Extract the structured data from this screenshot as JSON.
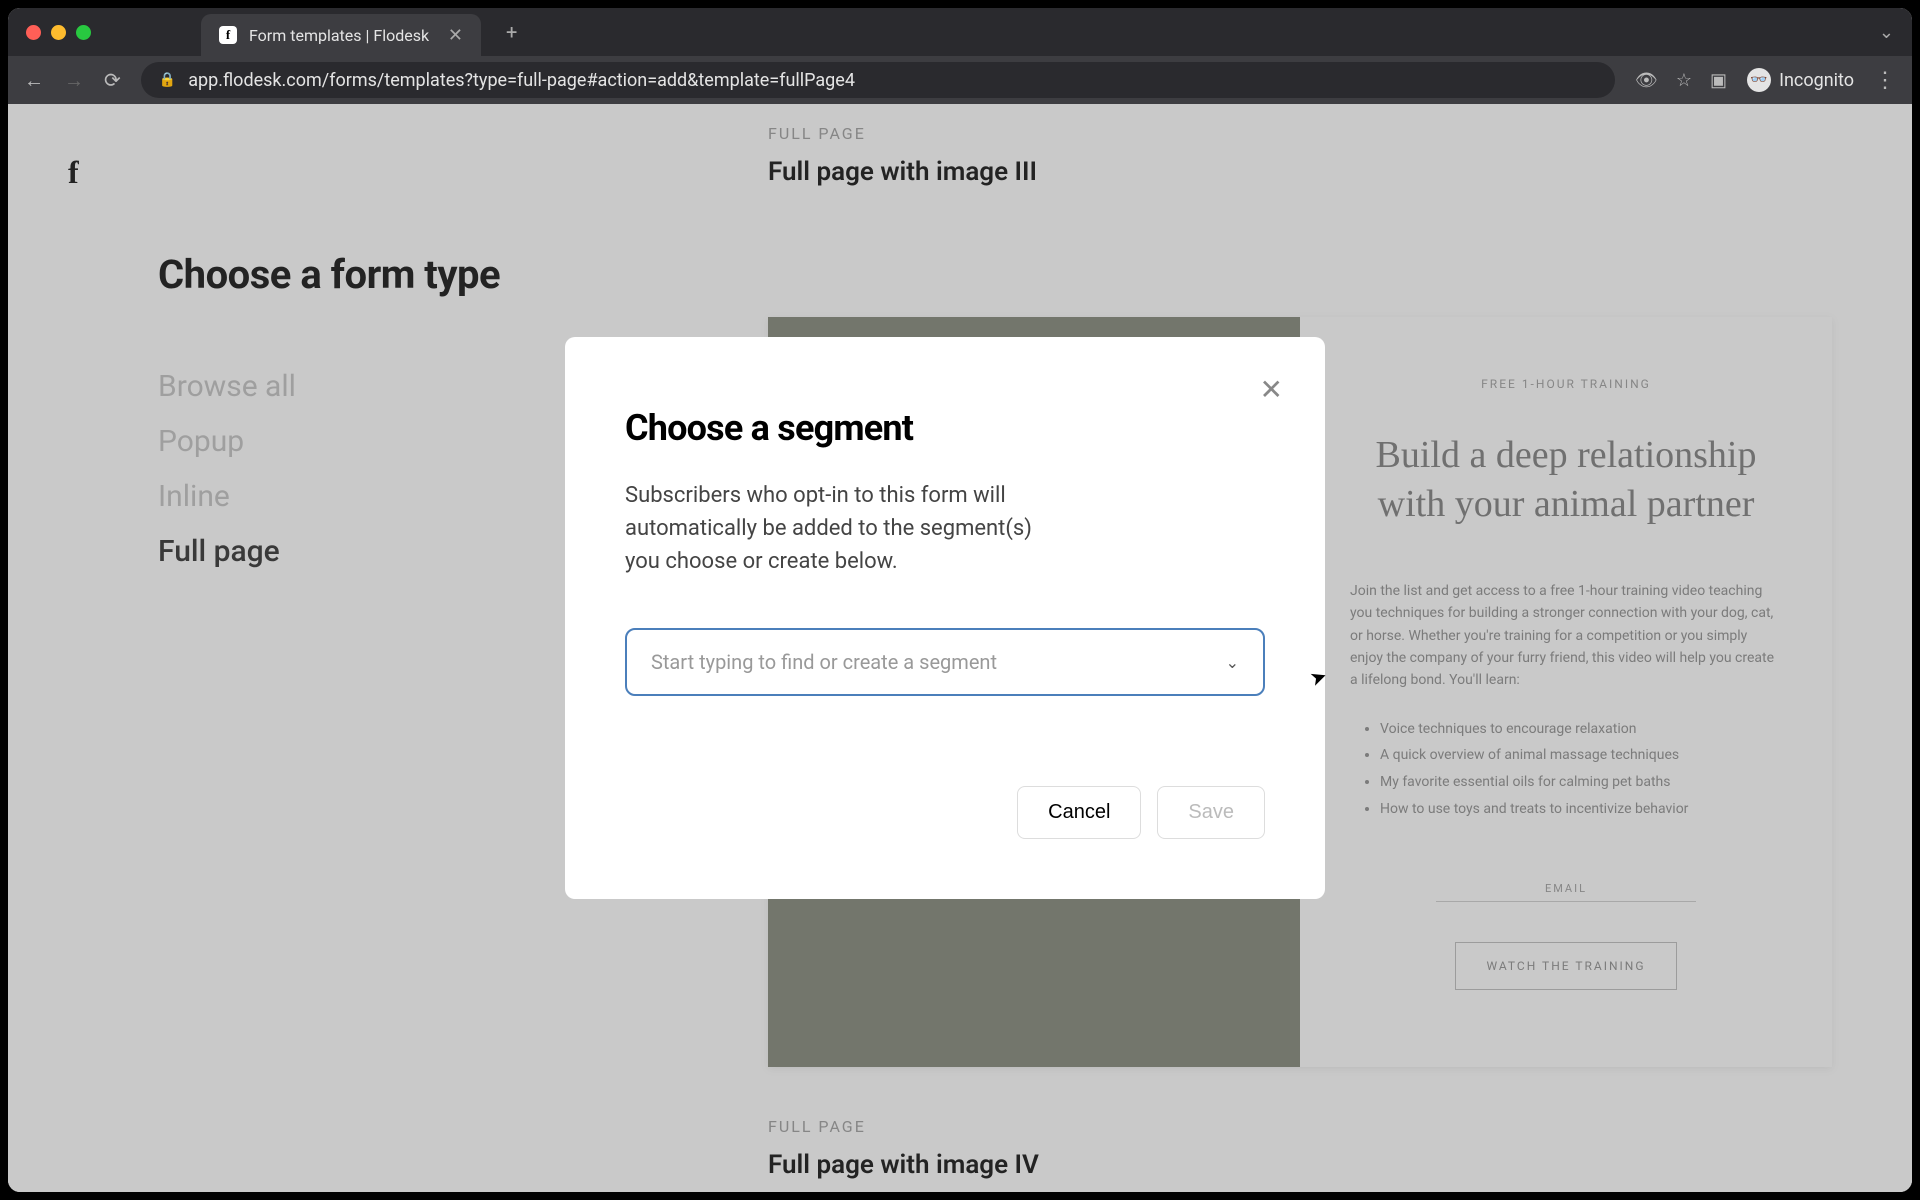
{
  "browser": {
    "tab_title": "Form templates | Flodesk",
    "url": "app.flodesk.com/forms/templates?type=full-page#action=add&template=fullPage4",
    "incognito_label": "Incognito"
  },
  "sidebar": {
    "heading": "Choose a form type",
    "items": [
      {
        "label": "Browse all"
      },
      {
        "label": "Popup"
      },
      {
        "label": "Inline"
      },
      {
        "label": "Full page"
      }
    ]
  },
  "main": {
    "template1": {
      "category": "FULL PAGE",
      "title": "Full page with image III"
    },
    "template2": {
      "category": "FULL PAGE",
      "title": "Full page with image IV"
    },
    "preview": {
      "eyebrow": "FREE 1-HOUR TRAINING",
      "headline": "Build a deep relationship with your animal partner",
      "body": "Join the list and get access to a free 1-hour training video teaching you techniques for building a stronger connection with your dog, cat, or horse. Whether you're training for a competition or you simply enjoy the company of your furry friend, this video will help you create a lifelong bond. You'll learn:",
      "bullets": [
        "Voice techniques to encourage relaxation",
        "A quick overview of animal massage techniques",
        "My favorite essential oils for calming pet baths",
        "How to use toys and treats to incentivize behavior"
      ],
      "email_label": "EMAIL",
      "cta": "WATCH THE TRAINING"
    }
  },
  "modal": {
    "title": "Choose a segment",
    "body": "Subscribers who opt-in to this form will automatically be added to the segment(s) you choose or create below.",
    "placeholder": "Start typing to find or create a segment",
    "cancel": "Cancel",
    "save": "Save"
  }
}
